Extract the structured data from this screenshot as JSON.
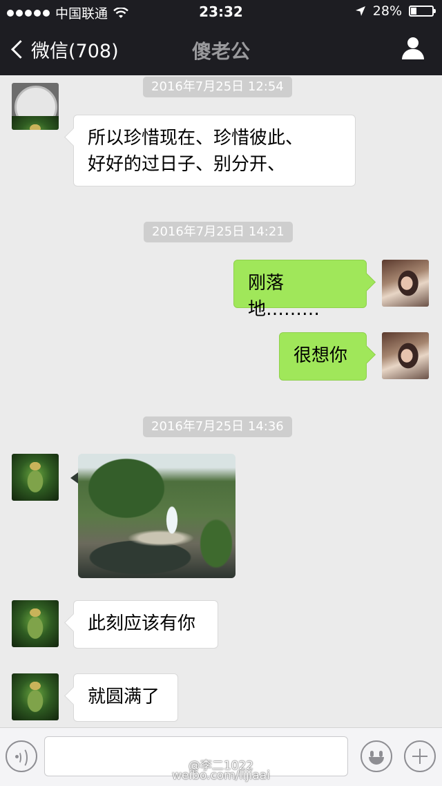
{
  "status_bar": {
    "carrier": "中国联通",
    "time": "23:32",
    "battery_percent_text": "28%",
    "battery_level": 0.28
  },
  "nav": {
    "back_label": "微信(708)",
    "title": "傻老公"
  },
  "messages": [
    {
      "type": "timestamp",
      "text": "2016年7月25日 12:54"
    },
    {
      "type": "text",
      "direction": "incoming",
      "lines": [
        "所以珍惜现在、珍惜彼此、",
        "好好的过日子、别分开、"
      ]
    },
    {
      "type": "timestamp",
      "text": "2016年7月25日 14:21"
    },
    {
      "type": "text",
      "direction": "outgoing",
      "text": "刚落地………"
    },
    {
      "type": "text",
      "direction": "outgoing",
      "text": "很想你"
    },
    {
      "type": "timestamp",
      "text": "2016年7月25日 14:36"
    },
    {
      "type": "image",
      "direction": "incoming",
      "description_icon": "waterfall-photo"
    },
    {
      "type": "text",
      "direction": "incoming",
      "text": "此刻应该有你"
    },
    {
      "type": "text",
      "direction": "incoming",
      "text": "就圆满了"
    }
  ],
  "input_bar": {
    "voice_icon": "voice-icon",
    "emoji_icon": "emoji-icon",
    "plus_icon": "plus-icon"
  },
  "watermark": {
    "line1": "@李二1022",
    "line2": "weibo.com/lijiaai"
  },
  "colors": {
    "bar_bg": "#1d1d22",
    "chat_bg": "#ebebeb",
    "outgoing_bubble": "#a0e75a",
    "incoming_bubble": "#ffffff",
    "timestamp_chip": "#cecece"
  }
}
